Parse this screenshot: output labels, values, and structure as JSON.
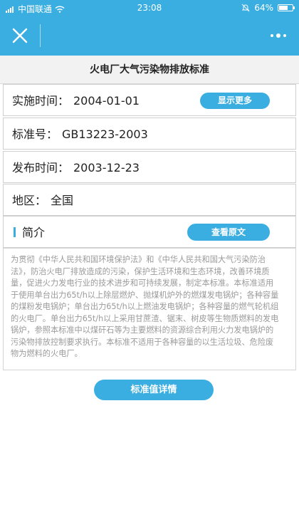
{
  "status_bar": {
    "carrier": "中国联通",
    "time": "23:08",
    "battery_text": "64%",
    "battery_level": 0.64,
    "icons": [
      "signal-icon",
      "wifi-icon",
      "mute-bell-icon",
      "battery-icon"
    ]
  },
  "navbar": {
    "close_icon": "close-icon",
    "more_icon": "more-dots-icon",
    "color": "#3aaee0"
  },
  "page": {
    "title": "火电厂大气污染物排放标准"
  },
  "fields": {
    "implement_label": "实施时间：",
    "implement_value": "2004-01-01",
    "show_more_label": "显示更多",
    "standard_no_label": "标准号：",
    "standard_no_value": "GB13223-2003",
    "publish_label": "发布时间：",
    "publish_value": "2003-12-23",
    "region_label": "地区：",
    "region_value": "全国",
    "intro_label": "简介",
    "view_original_label": "查看原文"
  },
  "description": {
    "lines": [
      "为贯彻《中华人民共和国环境保护法》和《中华人民共和国大气污染防治",
      "法》，防治火电厂排放造成的污染，保护生活环境和生态环境，改善环境质",
      "量，促进火力发电行业的技术进步和可持续发展，制定本标准。本标准适用",
      "于使用单台出力65t/h以上除层燃炉、抛煤机炉外的燃煤发电锅炉；各种容量",
      "的煤粉发电锅炉；单台出力65t/h以上燃油发电锅炉；各种容量的燃气轮机组",
      "的火电厂。单台出力65t/h以上采用甘蔗渣、锯末、树皮等生物质燃料的发电",
      "锅炉，参照本标准中以煤矸石等为主要燃料的资源综合利用火力发电锅炉的",
      "污染物排放控制要求执行。本标准不适用于各种容量的以生活垃圾、危险废",
      "物为燃料的火电厂。"
    ]
  },
  "actions": {
    "detail_button": "标准值详情"
  }
}
